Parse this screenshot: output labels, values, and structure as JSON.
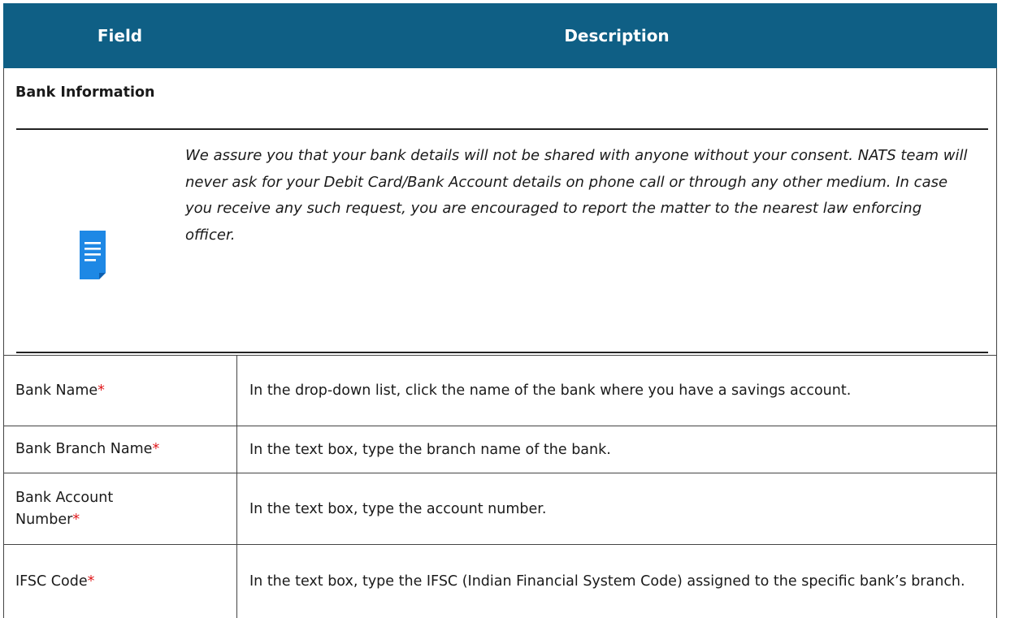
{
  "header": {
    "field": "Field",
    "description": "Description"
  },
  "section": {
    "title": "Bank Information",
    "note_icon": "document-note-icon",
    "note": "We assure you that your bank details will not be shared with anyone without your consent. NATS team will never ask for your Debit Card/Bank Account details on phone call or through any other medium. In case you receive any such request, you are encouraged to report the matter to the nearest law enforcing officer."
  },
  "required_marker": "*",
  "rows": [
    {
      "field": "Bank Name",
      "description": "In the drop-down list, click the name of the bank where you have a savings account."
    },
    {
      "field": "Bank Branch Name",
      "description": "In the text box, type the branch name of the bank."
    },
    {
      "field": "Bank Account Number",
      "description": "In the text box, type the account number."
    },
    {
      "field": "IFSC Code",
      "description": "In the text box, type the IFSC (Indian Financial System Code) assigned to the specific bank’s branch."
    }
  ],
  "colors": {
    "header_bg": "#0f5f85",
    "required": "#e0191c",
    "icon": "#1e88e5"
  }
}
